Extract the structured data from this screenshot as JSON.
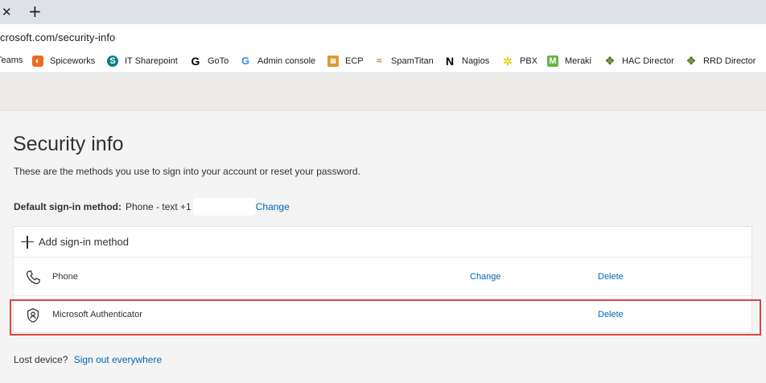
{
  "browser": {
    "tab_close_glyph": "✕",
    "new_tab_glyph": "+",
    "url": "crosoft.com/security-info",
    "bookmarks": [
      {
        "label": "Teams",
        "icon": "teams-icon"
      },
      {
        "label": "Spiceworks",
        "icon": "spiceworks-icon",
        "color": "#f06a1d"
      },
      {
        "label": "IT Sharepoint",
        "icon": "sharepoint-icon",
        "color": "#038387"
      },
      {
        "label": "GoTo",
        "icon": "goto-icon",
        "color": "#000000"
      },
      {
        "label": "Admin console",
        "icon": "google-icon",
        "color": "#4285f4"
      },
      {
        "label": "ECP",
        "icon": "ecp-icon",
        "color": "#d69b2d"
      },
      {
        "label": "SpamTitan",
        "icon": "spamtitan-icon",
        "color": "#e46b1f"
      },
      {
        "label": "Nagios",
        "icon": "nagios-icon",
        "color": "#000000"
      },
      {
        "label": "PBX",
        "icon": "pbx-icon",
        "color": "#e8d02a"
      },
      {
        "label": "Meraki",
        "icon": "meraki-icon",
        "color": "#67b346"
      },
      {
        "label": "HAC Director",
        "icon": "hac-director-icon",
        "color": "#5b7a2b"
      },
      {
        "label": "RRD Director",
        "icon": "rrd-director-icon",
        "color": "#5b7a2b"
      }
    ]
  },
  "page": {
    "title": "Security info",
    "description": "These are the methods you use to sign into your account or reset your password.",
    "default_method": {
      "label": "Default sign-in method:",
      "value": "Phone - text +1",
      "change_link": "Change"
    },
    "add_method_label": "Add sign-in method",
    "methods": [
      {
        "name": "Phone",
        "icon": "phone-icon",
        "change": "Change",
        "delete": "Delete"
      },
      {
        "name": "Microsoft Authenticator",
        "icon": "authenticator-icon",
        "delete": "Delete"
      }
    ],
    "lost_device": {
      "label": "Lost device?",
      "link": "Sign out everywhere"
    }
  },
  "colors": {
    "link": "#0067b8",
    "highlight": "#d6463f"
  }
}
